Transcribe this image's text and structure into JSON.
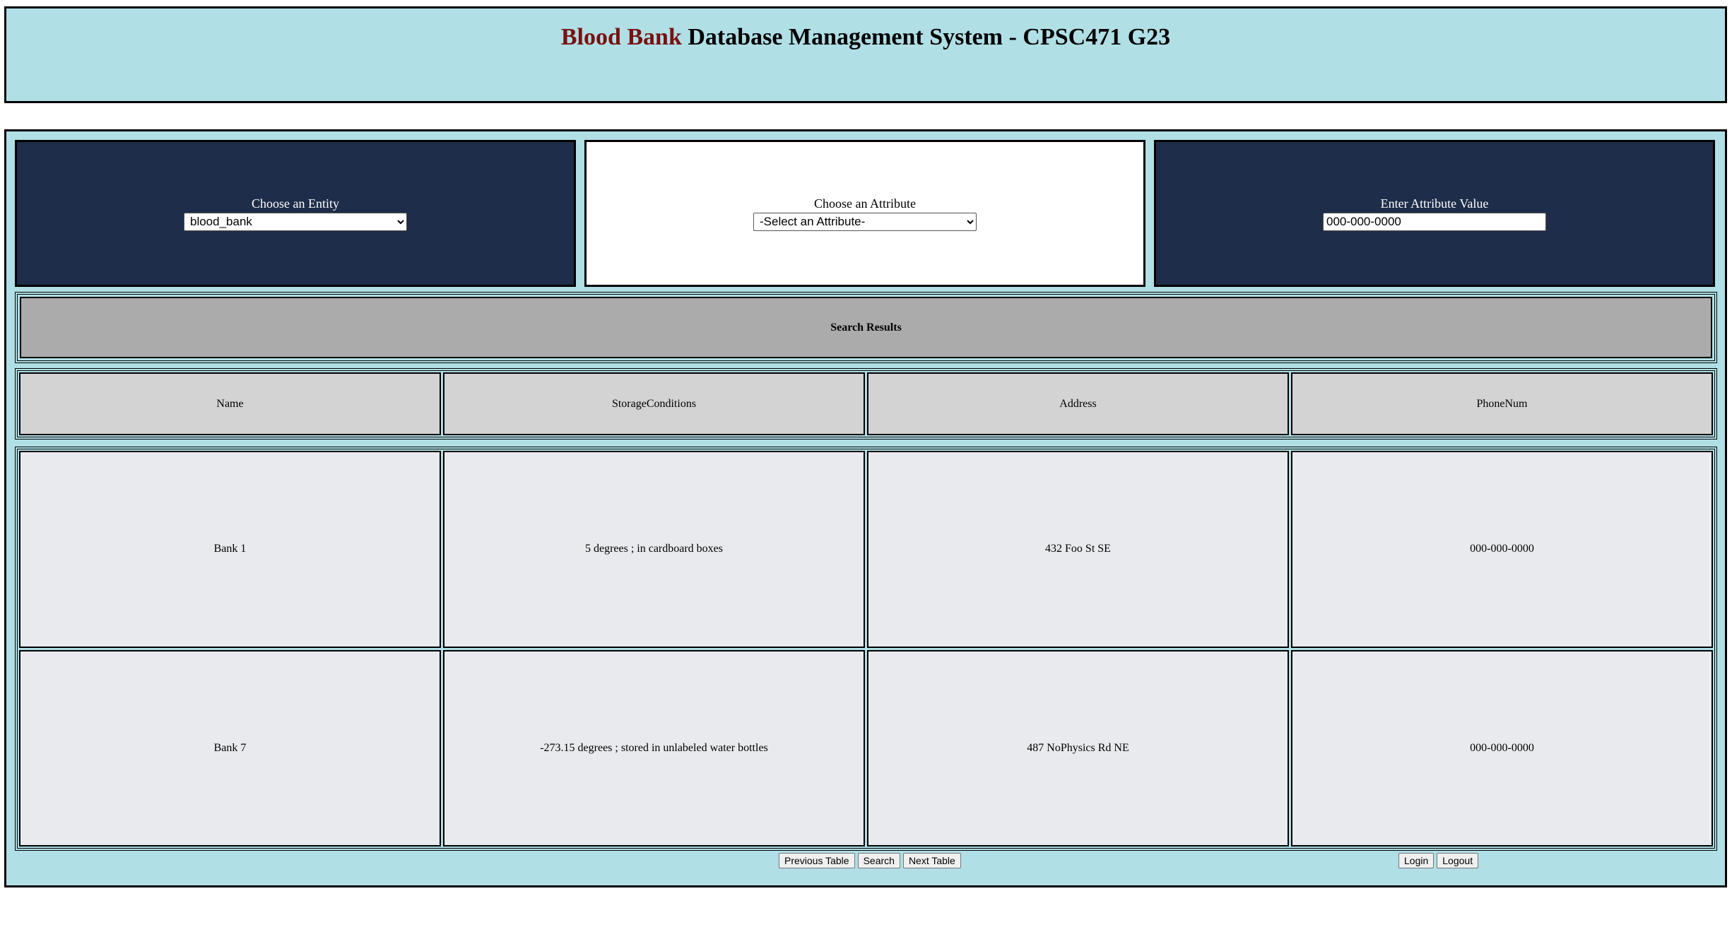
{
  "header": {
    "brand": "Blood Bank",
    "title_rest": " Database Management System - CPSC471 G23"
  },
  "entity_box": {
    "label": "Choose an Entity",
    "selected": "blood_bank"
  },
  "attribute_box": {
    "label": "Choose an Attribute",
    "selected": "-Select an Attribute-"
  },
  "value_box": {
    "label": "Enter Attribute Value",
    "value": "000-000-0000"
  },
  "results": {
    "title": "Search Results",
    "columns": [
      "Name",
      "StorageConditions",
      "Address",
      "PhoneNum"
    ],
    "rows": [
      [
        "Bank 1",
        "5 degrees ; in cardboard boxes",
        "432 Foo St SE",
        "000-000-0000"
      ],
      [
        "Bank 7",
        "-273.15 degrees ; stored in unlabeled water bottles",
        "487 NoPhysics Rd NE",
        "000-000-0000"
      ]
    ]
  },
  "buttons": {
    "previous_table": "Previous Table",
    "search": "Search",
    "next_table": "Next Table",
    "login": "Login",
    "logout": "Logout"
  },
  "colors": {
    "panel_bg": "#b0dfe6",
    "dark_box": "#1e2d4a",
    "brand": "#7a1010",
    "results_bg": "#ababab",
    "header_cell": "#d3d3d3",
    "data_cell": "#e9eaed"
  }
}
